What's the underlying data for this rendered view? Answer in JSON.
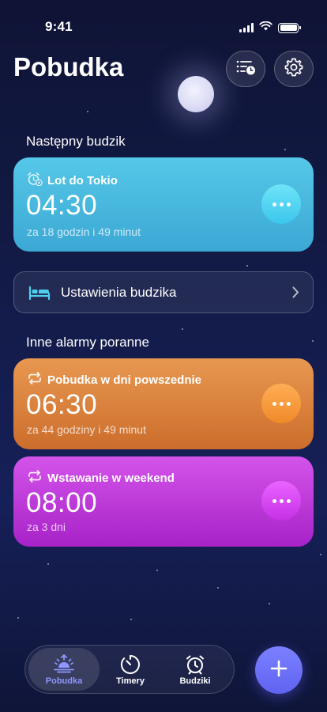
{
  "status_bar": {
    "time": "9:41"
  },
  "header": {
    "title": "Pobudka",
    "list_icon": "list-clock-icon",
    "settings_icon": "gear-icon"
  },
  "next_alarm": {
    "section_title": "Następny budzik",
    "label": "Lot do Tokio",
    "time": "04:30",
    "subtitle": "za 18 godzin i 49 minut",
    "icon": "alarm-plus-icon",
    "color": "#4bbbe0"
  },
  "alarm_settings": {
    "label": "Ustawienia budzika",
    "icon": "bed-icon"
  },
  "other_alarms": {
    "section_title": "Inne alarmy poranne",
    "items": [
      {
        "label": "Pobudka w dni powszednie",
        "time": "06:30",
        "subtitle": "za 44 godziny i 49 minut",
        "icon": "repeat-icon",
        "color": "#e08a45"
      },
      {
        "label": "Wstawanie w weekend",
        "time": "08:00",
        "subtitle": "za 3 dni",
        "icon": "repeat-icon",
        "color": "#c23edc"
      }
    ]
  },
  "tab_bar": {
    "tabs": [
      {
        "label": "Pobudka",
        "icon": "sunrise-icon",
        "active": true
      },
      {
        "label": "Timery",
        "icon": "timer-icon",
        "active": false
      },
      {
        "label": "Budziki",
        "icon": "alarm-clock-icon",
        "active": false
      }
    ],
    "add_icon": "plus-icon"
  },
  "colors": {
    "accent": "#6b6ff7",
    "background": "#121a45"
  }
}
